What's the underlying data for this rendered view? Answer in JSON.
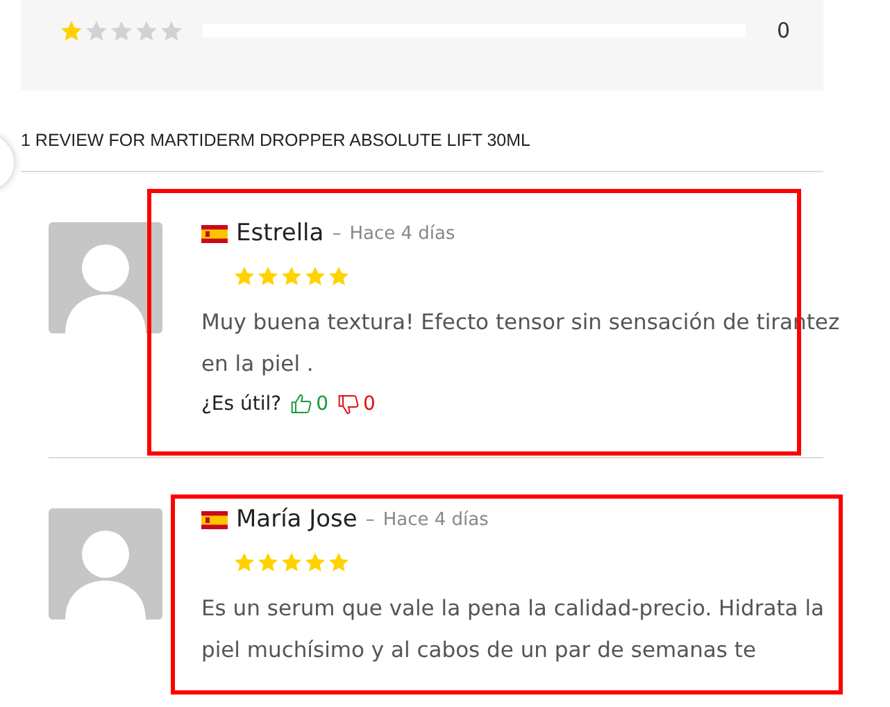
{
  "rating_breakdown": [
    {
      "stars": 1,
      "level": 0,
      "count": "0"
    }
  ],
  "reviews_heading": "1 REVIEW FOR MARTIDERM DROPPER ABSOLUTE LIFT 30ML",
  "reviews": [
    {
      "author": "Estrella",
      "separator": "–",
      "date": "Hace 4 días",
      "stars": 5,
      "text": "Muy buena textura! Efecto tensor sin sensación de tirantez en la piel .",
      "helpful_label": "¿Es útil?",
      "likes": "0",
      "dislikes": "0",
      "highlighted": true
    },
    {
      "author": "María Jose",
      "separator": "–",
      "date": "Hace 4 días",
      "stars": 5,
      "text": "Es un serum que vale la pena la calidad-precio. Hidrata la piel muchísimo y al cabos de un par de semanas te",
      "highlighted": true
    }
  ]
}
